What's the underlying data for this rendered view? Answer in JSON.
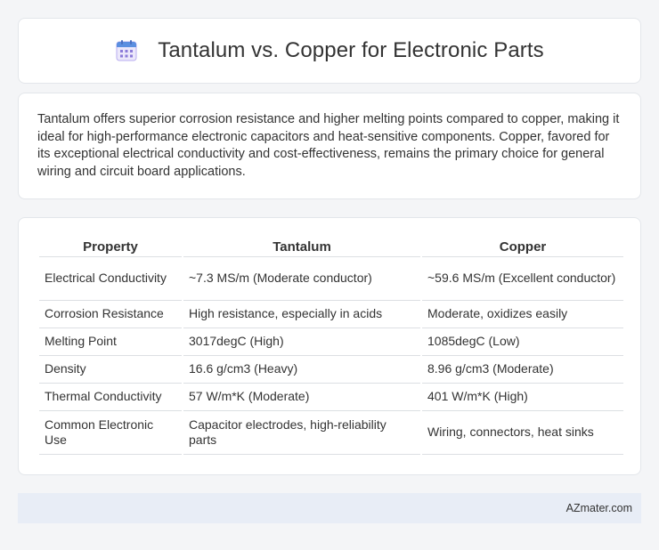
{
  "header": {
    "icon": "calendar-icon",
    "title": "Tantalum vs. Copper for Electronic Parts"
  },
  "summary": {
    "text": "Tantalum offers superior corrosion resistance and higher melting points compared to copper, making it ideal for high-performance electronic capacitors and heat-sensitive components. Copper, favored for its exceptional electrical conductivity and cost-effectiveness, remains the primary choice for general wiring and circuit board applications."
  },
  "table": {
    "headers": [
      "Property",
      "Tantalum",
      "Copper"
    ],
    "rows": [
      [
        "Electrical Conductivity",
        "~7.3 MS/m (Moderate conductor)",
        "~59.6 MS/m (Excellent conductor)"
      ],
      [
        "Corrosion Resistance",
        "High resistance, especially in acids",
        "Moderate, oxidizes easily"
      ],
      [
        "Melting Point",
        "3017degC (High)",
        "1085degC (Low)"
      ],
      [
        "Density",
        "16.6 g/cm3 (Heavy)",
        "8.96 g/cm3 (Moderate)"
      ],
      [
        "Thermal Conductivity",
        "57 W/m*K (Moderate)",
        "401 W/m*K (High)"
      ],
      [
        "Common Electronic Use",
        "Capacitor electrodes, high-reliability parts",
        "Wiring, connectors, heat sinks"
      ]
    ]
  },
  "footer": {
    "brand": "AZmater.com"
  },
  "colors": {
    "icon_accent": "#8c7bd9",
    "icon_top": "#5b8fe0",
    "footer_bg": "#e8edf6"
  }
}
